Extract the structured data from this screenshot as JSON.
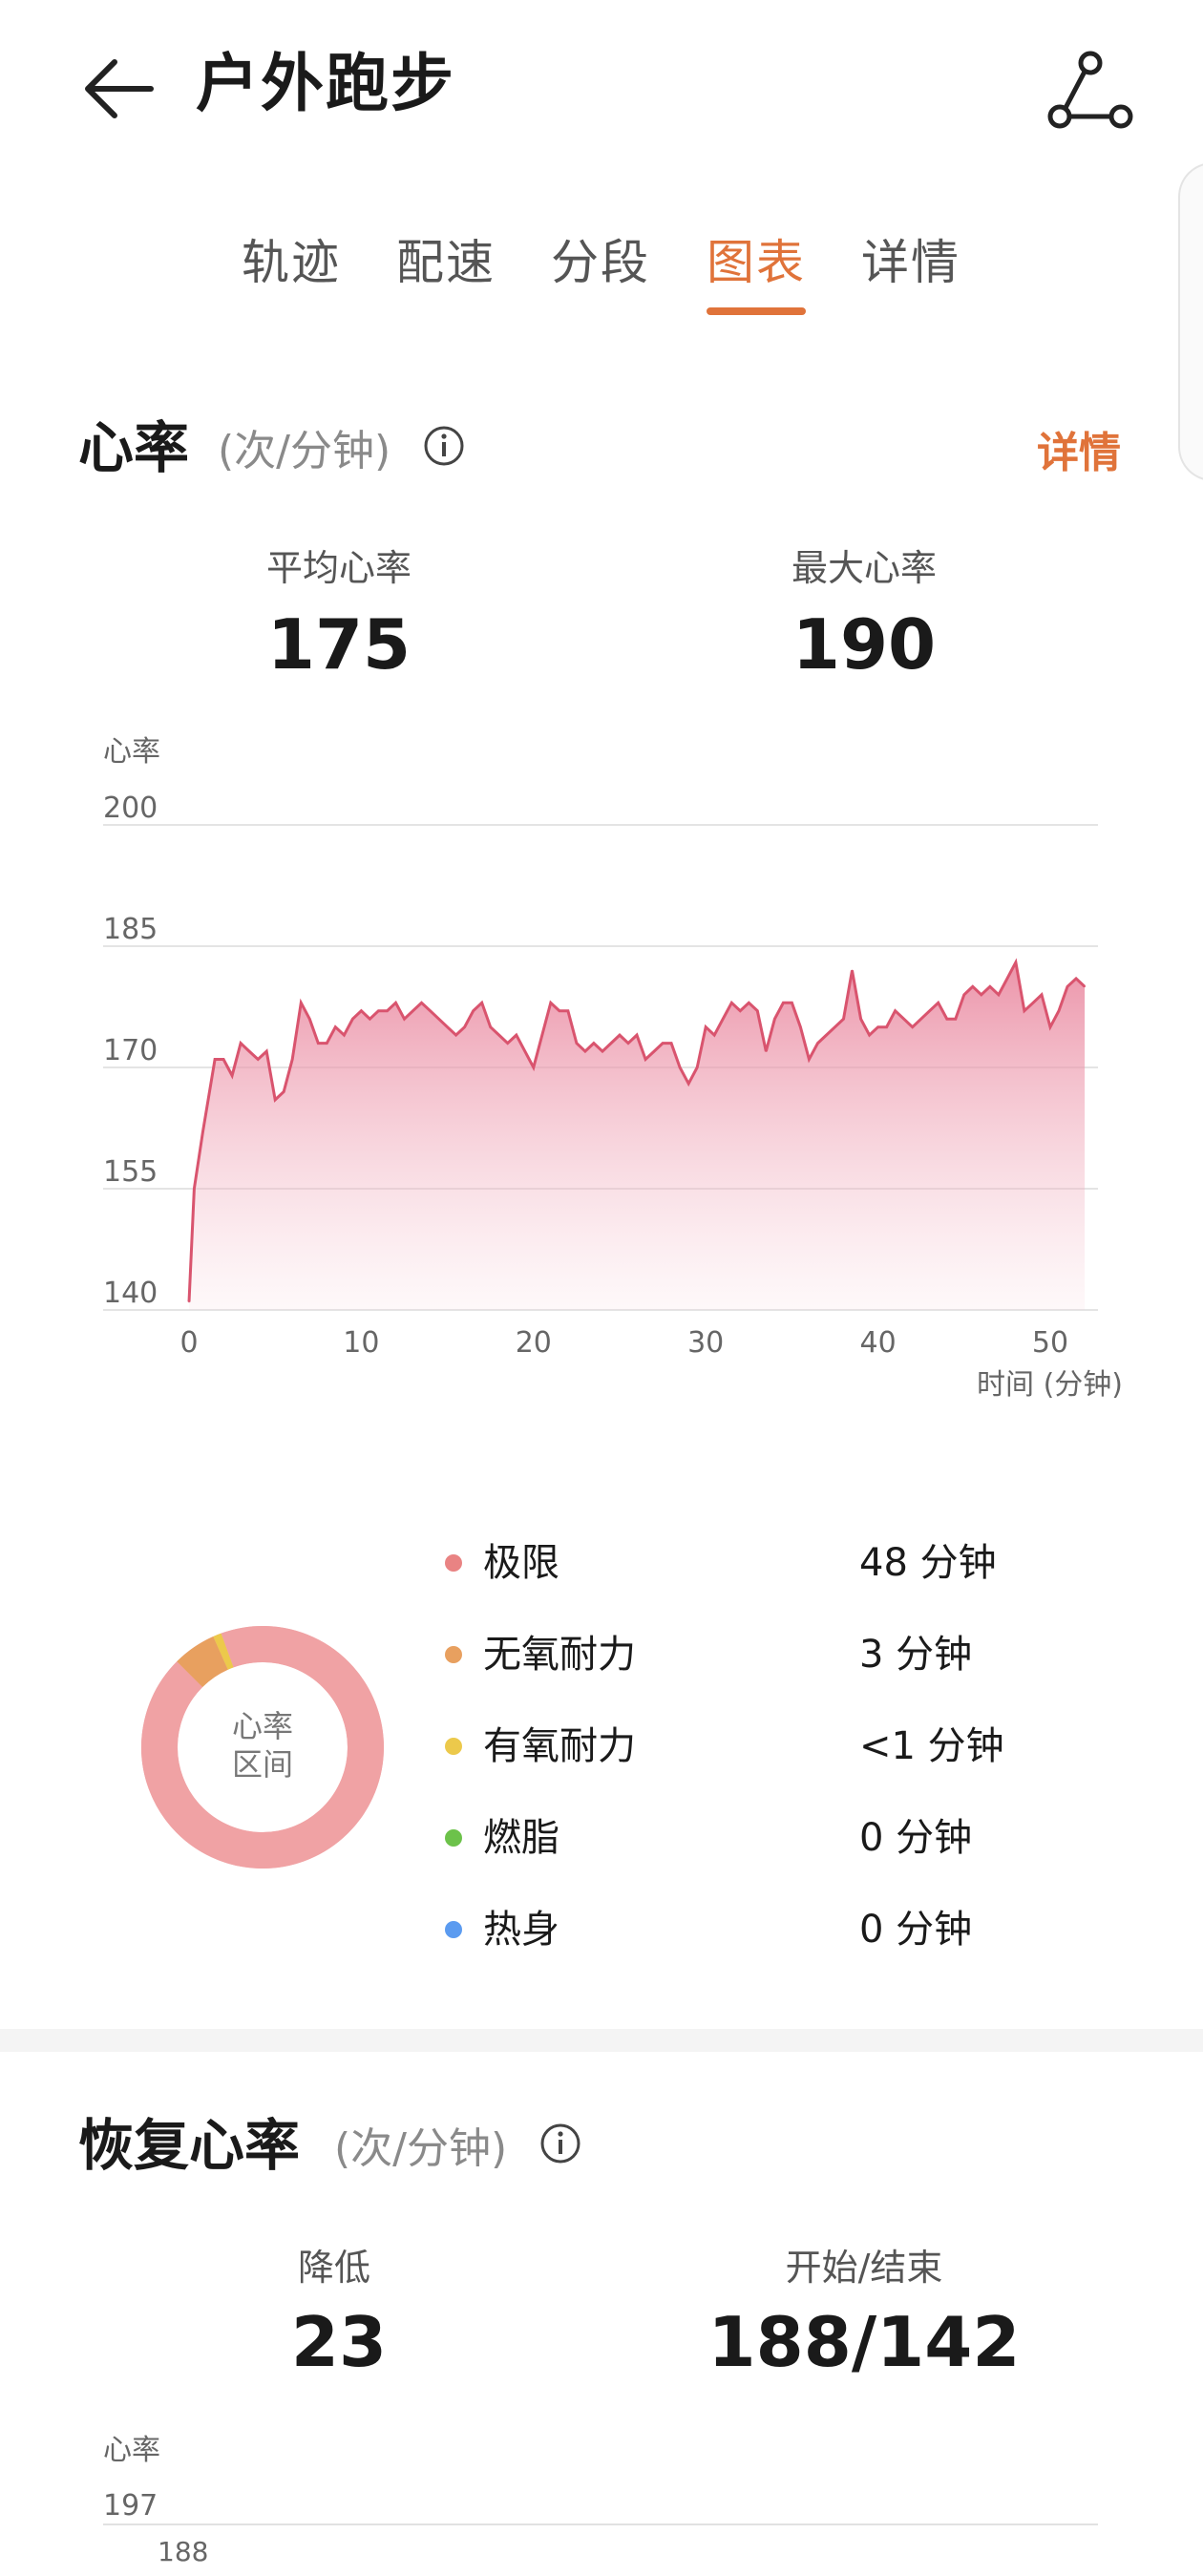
{
  "header": {
    "title": "户外跑步"
  },
  "tabs": [
    {
      "label": "轨迹"
    },
    {
      "label": "配速"
    },
    {
      "label": "分段"
    },
    {
      "label": "图表",
      "active": true
    },
    {
      "label": "详情"
    }
  ],
  "heart_rate": {
    "title": "心率",
    "unit": "(次/分钟)",
    "detail_link": "详情",
    "stats": [
      {
        "label": "平均心率",
        "value": "175"
      },
      {
        "label": "最大心率",
        "value": "190"
      }
    ]
  },
  "chart_data": {
    "type": "area",
    "ylabel": "心率",
    "xlabel": "时间 (分钟)",
    "ylim": [
      140,
      200
    ],
    "xlim": [
      0,
      52
    ],
    "yticks": [
      200,
      185,
      170,
      155,
      140
    ],
    "xticks": [
      0,
      10,
      20,
      30,
      40,
      50
    ],
    "grid": true,
    "color": "#d9546e",
    "series": [
      {
        "x": [
          0,
          0.3,
          0.8,
          1.5,
          2,
          2.5,
          3,
          3.5,
          4,
          4.5,
          5,
          5.5,
          6,
          6.5,
          7,
          7.5,
          8,
          8.5,
          9,
          9.5,
          10,
          10.5,
          11,
          11.5,
          12,
          12.5,
          13,
          13.5,
          14,
          14.5,
          15,
          15.5,
          16,
          16.5,
          17,
          17.5,
          18,
          18.5,
          19,
          19.5,
          20,
          20.5,
          21,
          21.5,
          22,
          22.5,
          23,
          23.5,
          24,
          24.5,
          25,
          25.5,
          26,
          26.5,
          27,
          27.5,
          28,
          28.5,
          29,
          29.5,
          30,
          30.5,
          31,
          31.5,
          32,
          32.5,
          33,
          33.5,
          34,
          34.5,
          35,
          35.5,
          36,
          36.5,
          37,
          37.5,
          38,
          38.5,
          39,
          39.5,
          40,
          40.5,
          41,
          41.5,
          42,
          42.5,
          43,
          43.5,
          44,
          44.5,
          45,
          45.5,
          46,
          46.5,
          47,
          47.5,
          48,
          48.5,
          49,
          49.5,
          50,
          50.5,
          51,
          51.5,
          52
        ],
        "y": [
          141,
          155,
          162,
          171,
          171,
          169,
          173,
          172,
          171,
          172,
          166,
          167,
          171,
          178,
          176,
          173,
          173,
          175,
          174,
          176,
          177,
          176,
          177,
          177,
          178,
          176,
          177,
          178,
          177,
          176,
          175,
          174,
          175,
          177,
          178,
          175,
          174,
          173,
          174,
          172,
          170,
          174,
          178,
          177,
          177,
          173,
          172,
          173,
          172,
          173,
          174,
          173,
          174,
          171,
          172,
          173,
          173,
          170,
          168,
          170,
          175,
          174,
          176,
          178,
          177,
          178,
          177,
          172,
          176,
          178,
          178,
          175,
          171,
          173,
          174,
          175,
          176,
          182,
          176,
          174,
          175,
          175,
          177,
          176,
          175,
          176,
          177,
          178,
          176,
          176,
          179,
          180,
          179,
          180,
          179,
          181,
          183,
          177,
          178,
          179,
          175,
          177,
          180,
          181,
          180
        ]
      }
    ]
  },
  "zones": {
    "center_label_1": "心率",
    "center_label_2": "区间",
    "items": [
      {
        "name": "极限",
        "duration": "48 分钟",
        "color": "#e98383",
        "minutes": 48
      },
      {
        "name": "无氧耐力",
        "duration": "3 分钟",
        "color": "#e8a05f",
        "minutes": 3
      },
      {
        "name": "有氧耐力",
        "duration": "<1 分钟",
        "color": "#ecc94b",
        "minutes": 0.6
      },
      {
        "name": "燃脂",
        "duration": "0 分钟",
        "color": "#6cc24a",
        "minutes": 0
      },
      {
        "name": "热身",
        "duration": "0 分钟",
        "color": "#5b9bf0",
        "minutes": 0
      }
    ]
  },
  "recovery": {
    "title": "恢复心率",
    "unit": "(次/分钟)",
    "stats": [
      {
        "label": "降低",
        "value": "23"
      },
      {
        "label": "开始/结束",
        "value": "188/142"
      }
    ],
    "chart": {
      "ylabel": "心率",
      "ytick": "197",
      "first_value": "188"
    }
  }
}
